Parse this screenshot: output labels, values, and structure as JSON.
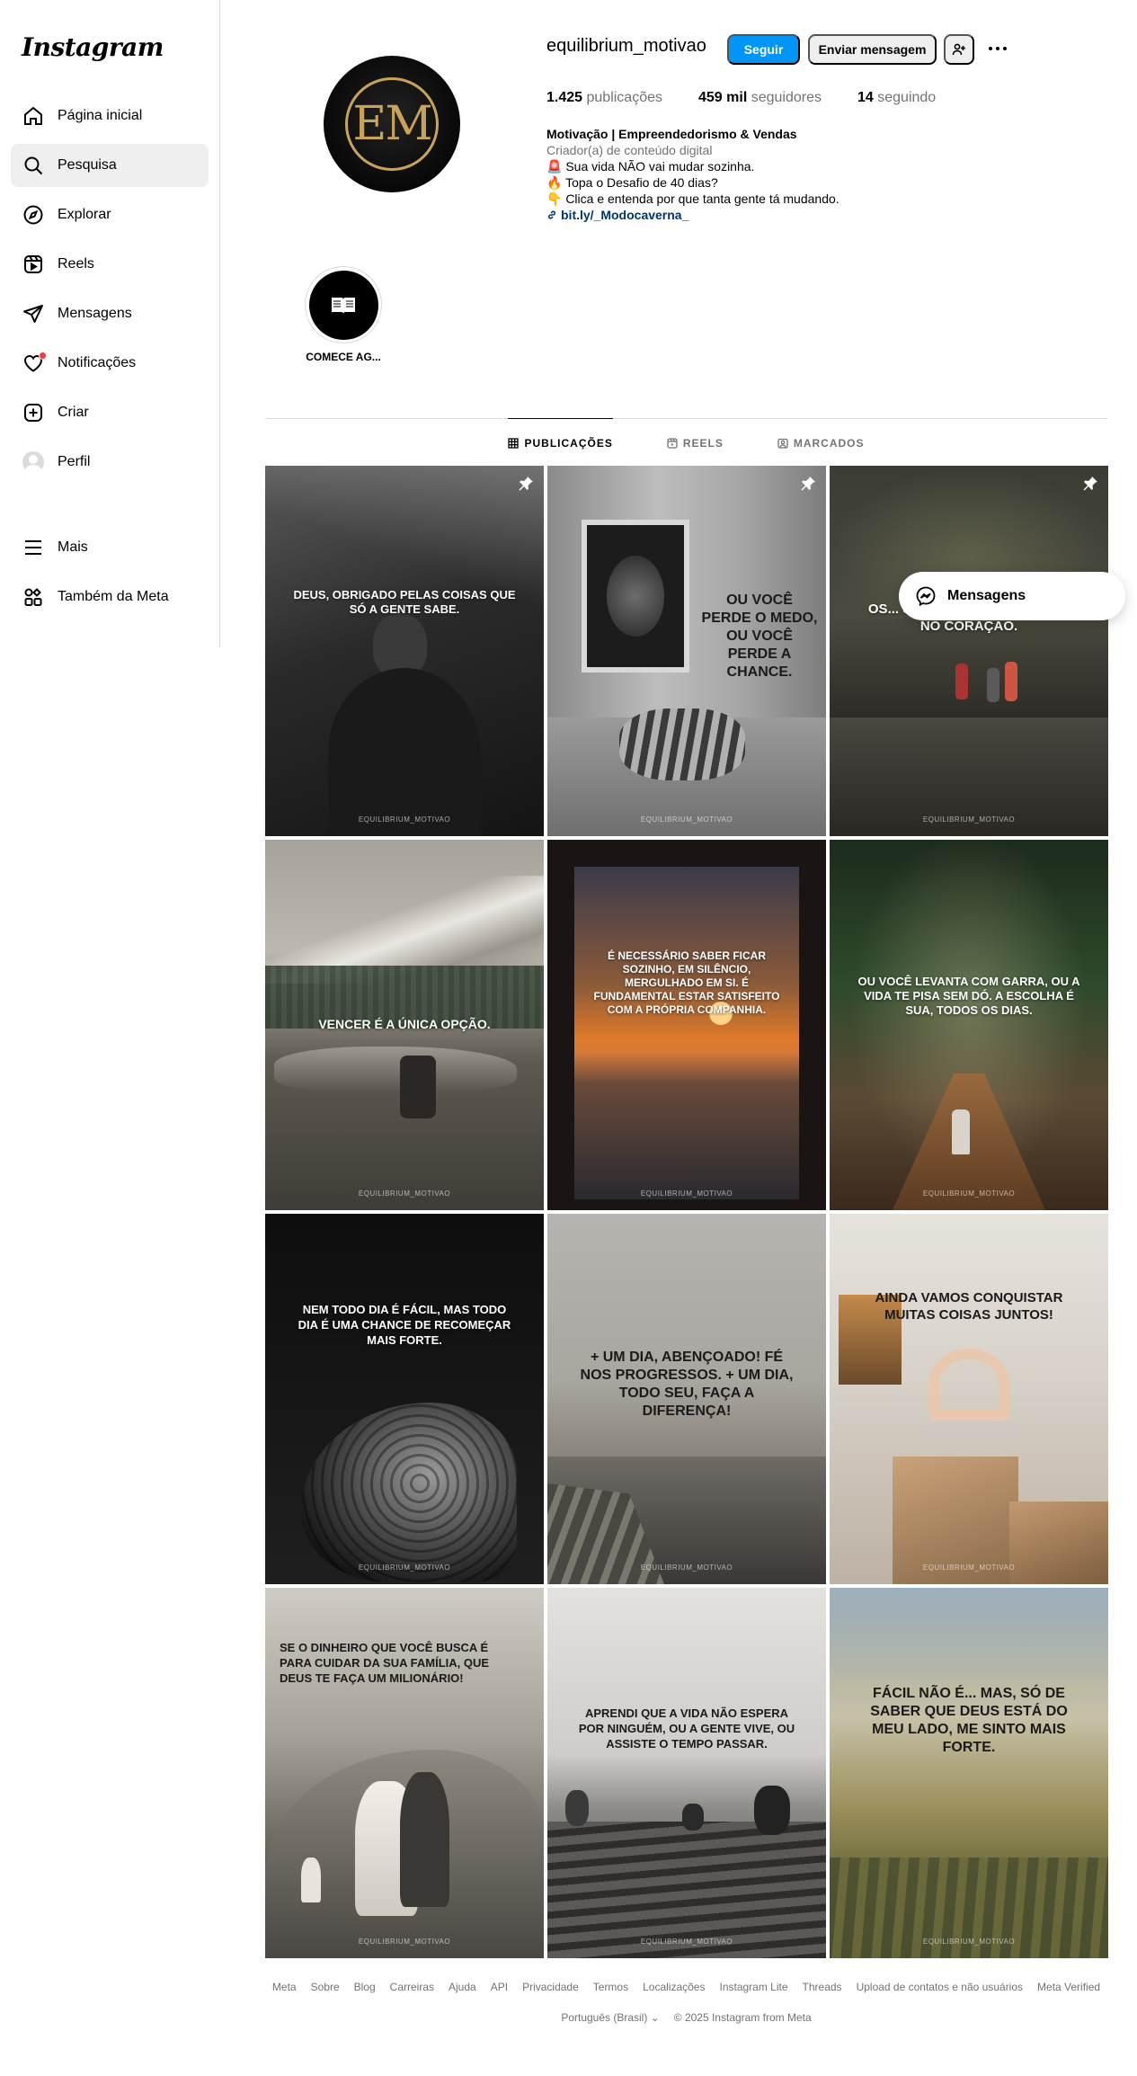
{
  "brand": {
    "logo_text": "Instagram"
  },
  "sidebar": {
    "items": [
      {
        "label": "Página inicial",
        "icon": "home-icon"
      },
      {
        "label": "Pesquisa",
        "icon": "search-icon"
      },
      {
        "label": "Explorar",
        "icon": "compass-icon"
      },
      {
        "label": "Reels",
        "icon": "reels-icon"
      },
      {
        "label": "Mensagens",
        "icon": "send-icon"
      },
      {
        "label": "Notificações",
        "icon": "heart-icon"
      },
      {
        "label": "Criar",
        "icon": "plus-square-icon"
      },
      {
        "label": "Perfil",
        "icon": "avatar"
      },
      {
        "label": "Mais",
        "icon": "menu-icon"
      },
      {
        "label": "Também da Meta",
        "icon": "meta-apps-icon"
      }
    ]
  },
  "profile": {
    "initials": "EM",
    "username": "equilibrium_motivao",
    "follow_label": "Seguir",
    "message_label": "Enviar mensagem",
    "stats": {
      "posts_num": "1.425",
      "posts_label": "publicações",
      "followers_num": "459 mil",
      "followers_label": "seguidores",
      "following_num": "14",
      "following_label": "seguindo"
    },
    "bio": {
      "name": "Motivação | Empreendedorismo & Vendas",
      "category": "Criador(a) de conteúdo digital",
      "line1": "🚨 Sua vida NÃO vai mudar sozinha.",
      "line2": "🔥 Topa o Desafio de 40 dias?",
      "line3": "👇 Clica e entenda por que tanta gente tá mudando.",
      "link": "bit.ly/_Modocaverna_"
    }
  },
  "highlights": [
    {
      "label": "COMECE AG..."
    }
  ],
  "tabs": [
    {
      "label": "PUBLICAÇÕES",
      "icon": "grid-icon"
    },
    {
      "label": "REELS",
      "icon": "reels-icon"
    },
    {
      "label": "MARCADOS",
      "icon": "tagged-icon"
    }
  ],
  "posts": [
    {
      "caption": "Deus, obrigado pelas coisas que só a gente sabe.",
      "watermark": "EQUILIBRIUM_MOTIVAO",
      "pinned": true
    },
    {
      "caption": "Ou você perde o medo, ou você perde a chance.",
      "watermark": "EQUILIBRIUM_MOTIVAO",
      "pinned": true
    },
    {
      "caption": "Os... serão esquecidos, tá no coração.",
      "watermark": "EQUILIBRIUM_MOTIVAO",
      "pinned": true
    },
    {
      "caption": "Vencer é a única opção.",
      "watermark": "EQUILIBRIUM_MOTIVAO"
    },
    {
      "caption": "É necessário saber ficar sozinho, em silêncio, mergulhado em si. É fundamental estar satisfeito com a própria companhia.",
      "watermark": "EQUILIBRIUM_MOTIVAO"
    },
    {
      "caption": "Ou você levanta com garra, ou a vida te pisa sem dó. A escolha é sua, todos os dias.",
      "watermark": "EQUILIBRIUM_MOTIVAO"
    },
    {
      "caption": "Nem todo dia é fácil, mas todo dia é uma chance de recomeçar mais forte.",
      "watermark": "EQUILIBRIUM_MOTIVAO"
    },
    {
      "caption": "+ um dia, abençoado! Fé nos progressos. + um dia, todo seu, faça a diferença!",
      "watermark": "EQUILIBRIUM_MOTIVAO"
    },
    {
      "caption": "Ainda vamos conquistar muitas coisas juntos!",
      "watermark": "EQUILIBRIUM_MOTIVAO"
    },
    {
      "caption": "Se o dinheiro que você busca é para cuidar da sua família, que Deus te faça um milionário!",
      "watermark": "EQUILIBRIUM_MOTIVAO"
    },
    {
      "caption": "Aprendi que a vida não espera por ninguém, ou a gente vive, ou assiste o tempo passar.",
      "watermark": "EQUILIBRIUM_MOTIVAO"
    },
    {
      "caption": "Fácil não é... mas, só de saber que Deus está do meu lado, me sinto mais forte.",
      "watermark": "EQUILIBRIUM_MOTIVAO"
    }
  ],
  "floating": {
    "messages_label": "Mensagens"
  },
  "footer": {
    "links": [
      "Meta",
      "Sobre",
      "Blog",
      "Carreiras",
      "Ajuda",
      "API",
      "Privacidade",
      "Termos",
      "Localizações",
      "Instagram Lite",
      "Threads",
      "Upload de contatos e não usuários",
      "Meta Verified"
    ],
    "language": "Português (Brasil)",
    "copyright": "© 2025 Instagram from Meta"
  },
  "colors": {
    "accent": "#0095f6",
    "link": "#00376b",
    "muted": "#737373",
    "notif": "#ff3040",
    "gold": "#c8a45a"
  }
}
